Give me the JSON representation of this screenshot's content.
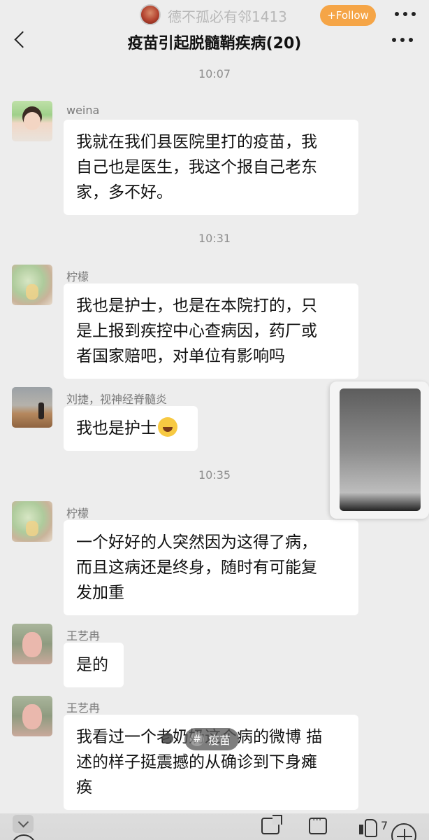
{
  "overlay": {
    "poster_name": "德不孤必有邻1413",
    "follow_label": "+Follow"
  },
  "chat": {
    "title": "疫苗引起脱髓鞘疾病(20)"
  },
  "messages": [
    {
      "time": "10:07"
    },
    {
      "sender": "weina",
      "lines": [
        "我就在我们县医院里打的疫苗，我",
        "自己也是医生，我这个报自己老东",
        "家，多不好。"
      ]
    },
    {
      "time": "10:31"
    },
    {
      "sender": "柠檬",
      "lines": [
        "我也是护士，也是在本院打的，只",
        "是上报到疾控中心查病因，药厂或",
        "者国家赔吧，对单位有影响吗"
      ]
    },
    {
      "sender": "刘捷，视神经脊髓炎",
      "lines": [
        "我也是护士"
      ],
      "emoji": "crying-laughing-emoji"
    },
    {
      "time": "10:35"
    },
    {
      "sender": "柠檬",
      "lines": [
        "一个好好的人突然因为这得了病，",
        "而且这病还是终身，随时有可能复",
        "发加重"
      ]
    },
    {
      "sender": "王艺冉",
      "lines": [
        "是的"
      ]
    },
    {
      "sender": "王艺冉",
      "lines": [
        "我看过一个老奶奶这个病的微博 描",
        "述的样子挺震撼的从确诊到下身瘫",
        "痪"
      ]
    }
  ],
  "hashtag": {
    "icon": "#",
    "label": "疫苗"
  },
  "bottom_bar": {
    "like_count": "7"
  }
}
